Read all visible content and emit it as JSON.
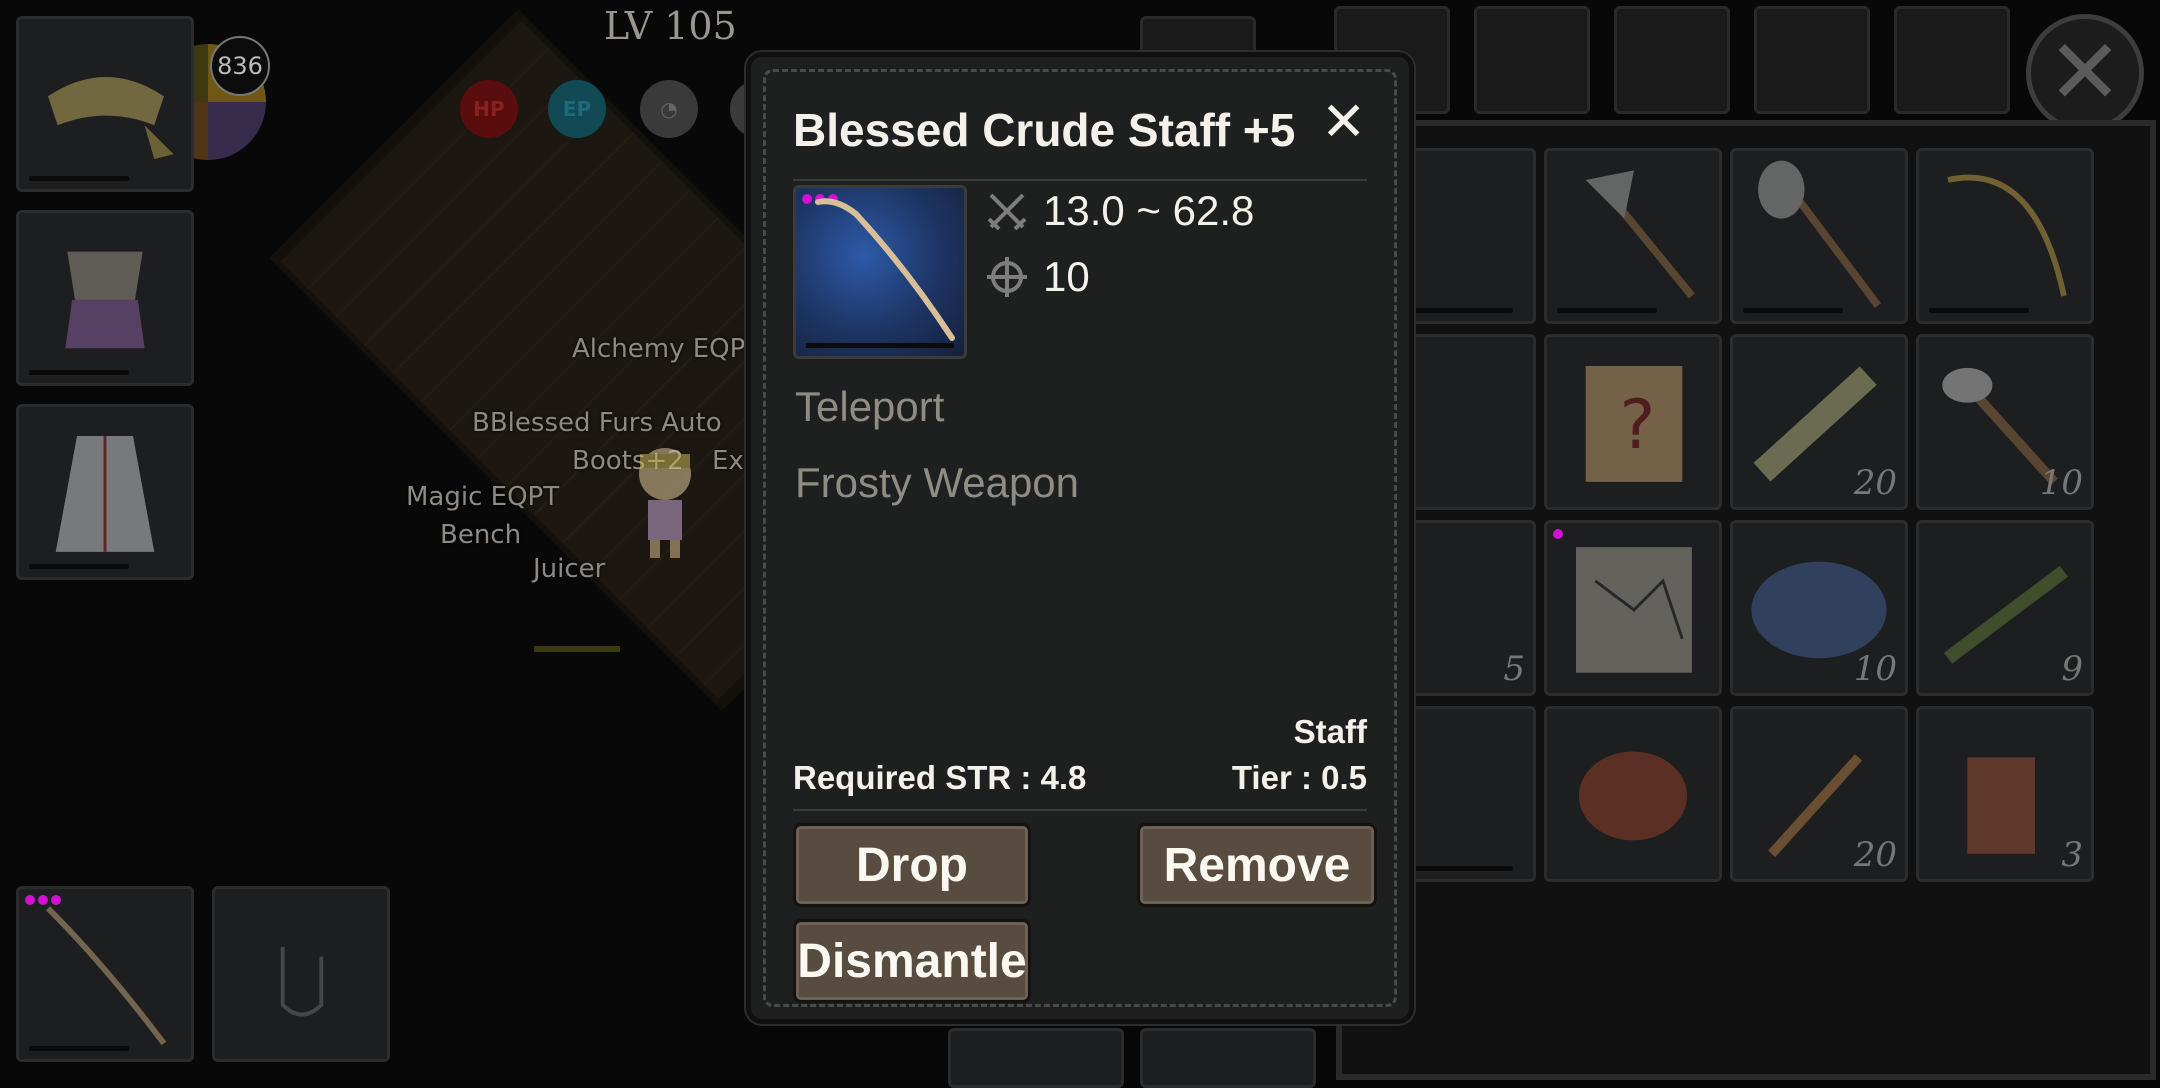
{
  "hud": {
    "level_label": "LV 105",
    "gauge_value": "836",
    "stat_hp": "HP",
    "stat_ep": "EP"
  },
  "map_labels": {
    "alchemy": "Alchemy EQP",
    "blessed": "BBlessed Furs Auto",
    "boots": "Boots+2",
    "ex": "Ex",
    "magic": "Magic EQPT",
    "bench": "Bench",
    "juicer": "Juicer"
  },
  "inventory": {
    "counts": [
      "20",
      "10",
      "5",
      "10",
      "9",
      "20",
      "3"
    ]
  },
  "dialog": {
    "title": "Blessed Crude Staff +5",
    "close_symbol": "✕",
    "damage": "13.0 ~ 62.8",
    "accuracy": "10",
    "abilities": [
      "Teleport",
      "Frosty Weapon"
    ],
    "weapon_type": "Staff",
    "required_str": "Required STR : 4.8",
    "tier": "Tier : 0.5",
    "buttons": {
      "drop": "Drop",
      "remove": "Remove",
      "dismantle": "Dismantle"
    }
  },
  "colors": {
    "dialog_bg": "#1e1f1f",
    "button_bg": "#584b40",
    "rarity_dot": "#d211d2",
    "ability_text": "#8f8c84"
  }
}
